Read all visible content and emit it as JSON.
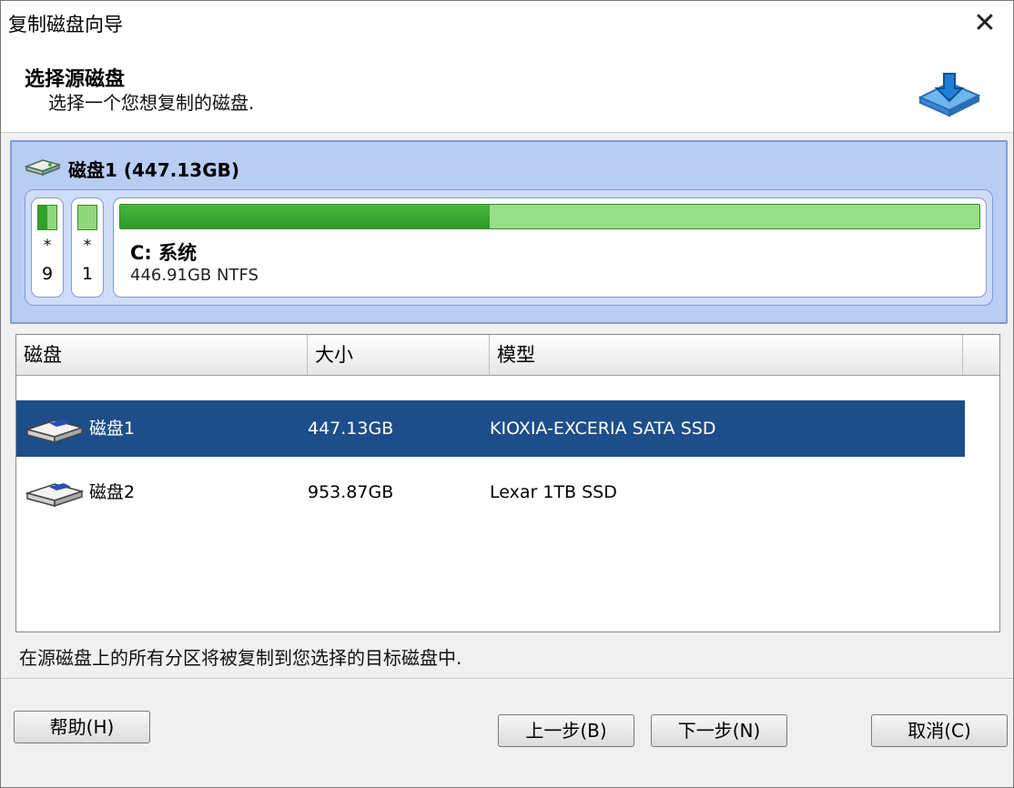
{
  "window": {
    "title": "复制磁盘向导",
    "close_glyph": "✕"
  },
  "header": {
    "title": "选择源磁盘",
    "subtitle": "选择一个您想复制的磁盘.",
    "icon": "disk-copy-icon"
  },
  "disk_panel": {
    "label": "磁盘1 (447.13GB)",
    "icon": "hard-disk-icon",
    "small_partitions": [
      {
        "star": "*",
        "number": "9"
      },
      {
        "star": "*",
        "number": "1"
      }
    ],
    "main_partition": {
      "name": "C: 系统",
      "info": "446.91GB NTFS",
      "used_fraction": 0.43
    }
  },
  "disk_list": {
    "columns": [
      "磁盘",
      "大小",
      "模型"
    ],
    "rows": [
      {
        "name": "磁盘1",
        "size": "447.13GB",
        "model": "KIOXIA-EXCERIA SATA SSD",
        "selected": true
      },
      {
        "name": "磁盘2",
        "size": "953.87GB",
        "model": "Lexar 1TB SSD",
        "selected": false
      }
    ]
  },
  "info_text": "在源磁盘上的所有分区将被复制到您选择的目标磁盘中.",
  "buttons": {
    "help": "帮助(H)",
    "back": "上一步(B)",
    "next": "下一步(N)",
    "cancel": "取消(C)"
  },
  "colors": {
    "selection": "#1d4e89",
    "panel": "#b9cdf2",
    "used_green": "#2fa32a",
    "free_green": "#97df86"
  }
}
